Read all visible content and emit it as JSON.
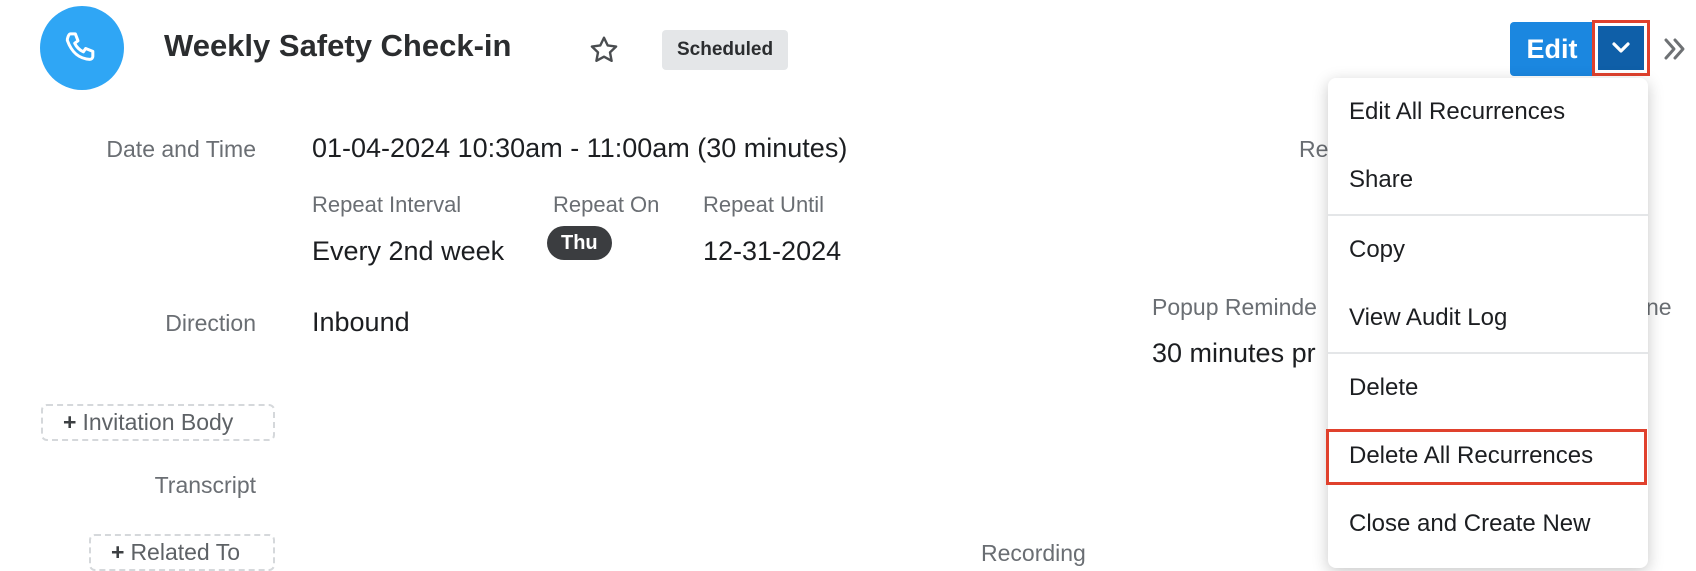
{
  "header": {
    "title": "Weekly Safety Check-in",
    "status_badge": "Scheduled",
    "edit_label": "Edit",
    "avatar_icon": "phone-icon",
    "favorite_icon": "star-icon",
    "more_icon": "double-chevron-right-icon"
  },
  "fields": {
    "date_time_label": "Date and Time",
    "date_time_value": "01-04-2024 10:30am - 11:00am (30 minutes)",
    "repeat_interval_label": "Repeat Interval",
    "repeat_interval_value": "Every 2nd week",
    "repeat_on_label": "Repeat On",
    "repeat_on_value": "Thu",
    "repeat_until_label": "Repeat Until",
    "repeat_until_value": "12-31-2024",
    "direction_label": "Direction",
    "direction_value": "Inbound",
    "popup_reminder_label_partial": "Popup Reminde",
    "popup_reminder_value_partial": "30 minutes pr",
    "right_label_partial": "Re",
    "right_label_partial2": "ne",
    "invitation_body_label": "Invitation Body",
    "transcript_label": "Transcript",
    "related_to_label": "Related To",
    "recording_label": "Recording"
  },
  "dropdown": {
    "items": [
      "Edit All Recurrences",
      "Share",
      "Copy",
      "View Audit Log",
      "Delete",
      "Delete All Recurrences",
      "Close and Create New"
    ]
  },
  "colors": {
    "accent": "#1b87e0",
    "avatar": "#2fa6f5",
    "highlight": "#e0412d"
  }
}
